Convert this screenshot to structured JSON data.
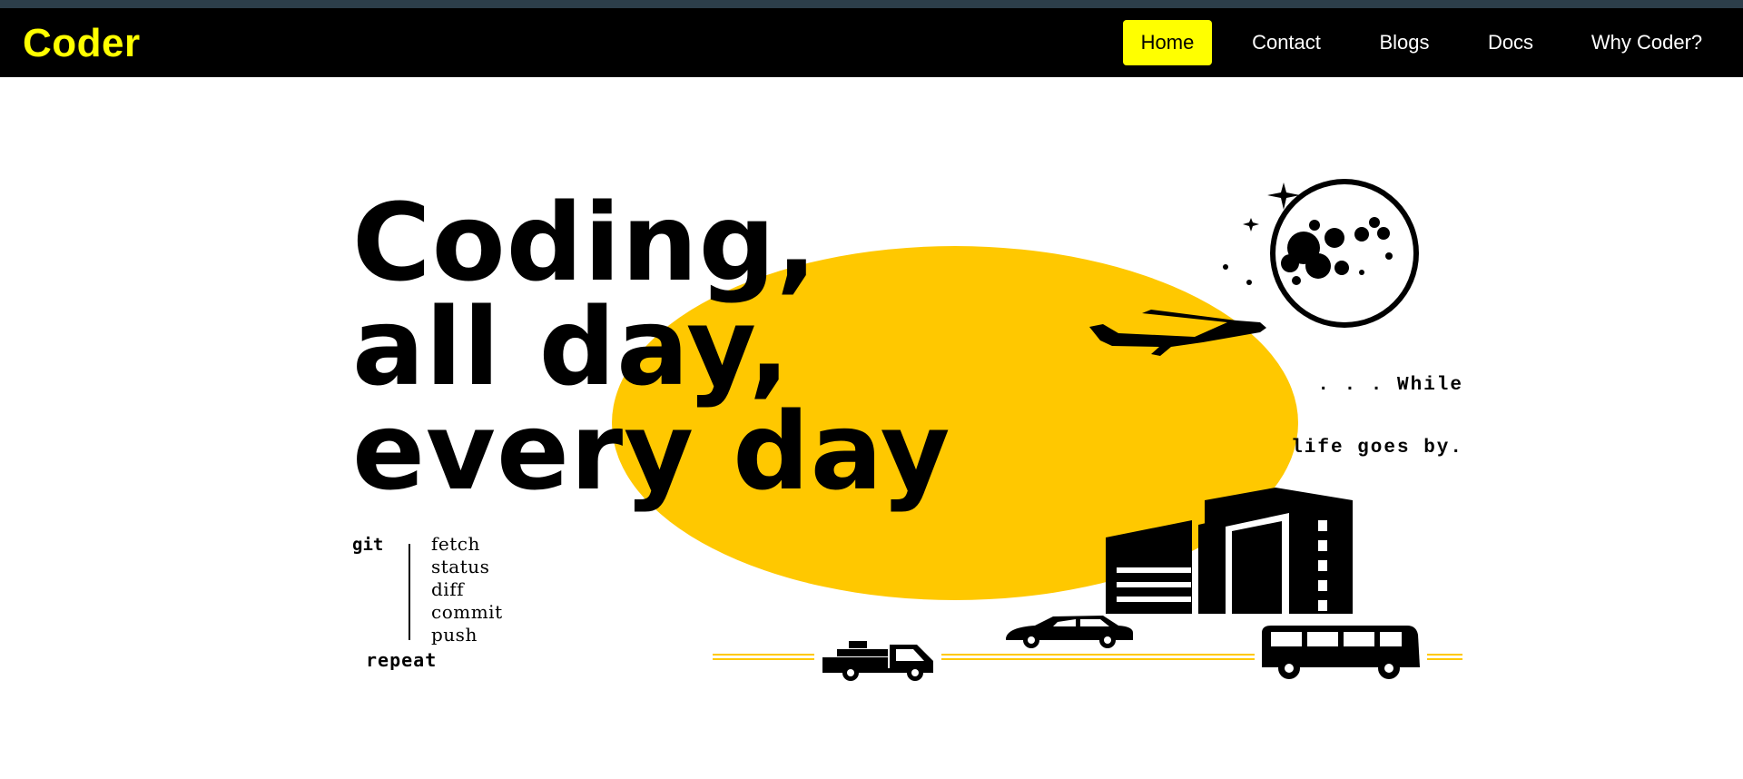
{
  "header": {
    "brand": "Coder",
    "nav": [
      {
        "label": "Home",
        "active": true
      },
      {
        "label": "Contact",
        "active": false
      },
      {
        "label": "Blogs",
        "active": false
      },
      {
        "label": "Docs",
        "active": false
      },
      {
        "label": "Why Coder?",
        "active": false
      }
    ]
  },
  "hero": {
    "headline": [
      "Coding,",
      "all day,",
      "every day"
    ],
    "git": {
      "word": "git",
      "commands": [
        "fetch",
        "status",
        "diff",
        "commit",
        "push"
      ],
      "repeat": "repeat"
    },
    "tagline": [
      ". . . While",
      "life goes by."
    ]
  },
  "colors": {
    "brand_yellow": "#ffff00",
    "sun_yellow": "#ffc800",
    "navbar_bg": "#000000",
    "top_strip": "#2c3e4a"
  },
  "icons": [
    "moon-icon",
    "star-icon",
    "airplane-icon",
    "building-icon",
    "truck-icon",
    "car-icon",
    "bus-icon"
  ]
}
